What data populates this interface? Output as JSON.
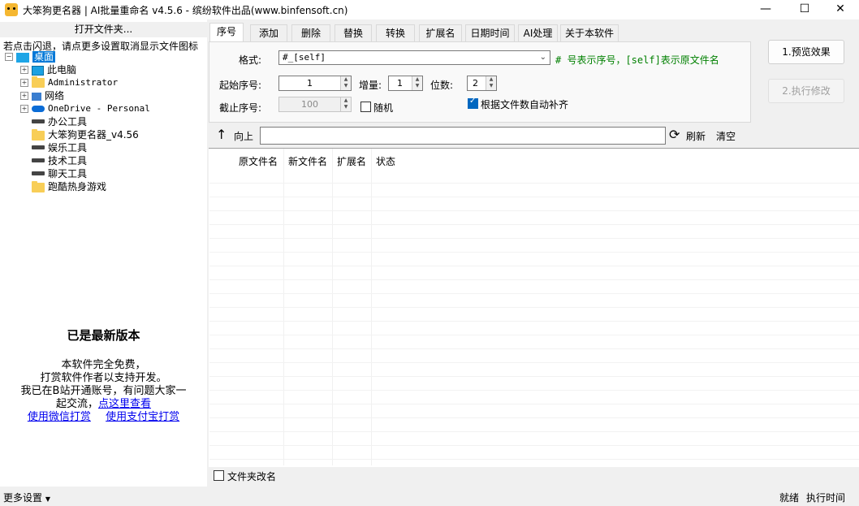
{
  "window": {
    "title": "大笨狗更名器 | AI批量重命名 v4.5.6 - 缤纷软件出品(www.binfensoft.cn)",
    "controls": {
      "minimize": "—",
      "maximize": "☐",
      "close": "✕"
    }
  },
  "left": {
    "open_folder": "打开文件夹...",
    "hint": "若点击闪退，请点更多设置取消显示文件图标",
    "tree": [
      {
        "label": "桌面",
        "icon": "desktop-icon"
      },
      {
        "label": "此电脑",
        "icon": "computer-icon"
      },
      {
        "label": "Administrator",
        "icon": "folder-icon"
      },
      {
        "label": "网络",
        "icon": "network-icon"
      },
      {
        "label": "OneDrive - Personal",
        "icon": "onedrive-icon"
      },
      {
        "label": "办公工具",
        "icon": "drive-icon"
      },
      {
        "label": "大笨狗更名器_v4.56",
        "icon": "folder-icon"
      },
      {
        "label": "娱乐工具",
        "icon": "drive-icon"
      },
      {
        "label": "技术工具",
        "icon": "drive-icon"
      },
      {
        "label": "聊天工具",
        "icon": "drive-icon"
      },
      {
        "label": "跑酷热身游戏",
        "icon": "folder-icon"
      }
    ],
    "info": {
      "latest": "已是最新版本",
      "line1": "本软件完全免费，",
      "line2": "打赏软件作者以支持开发。",
      "line3": "我已在B站开通账号，有问题大家一",
      "line4_prefix": "起交流，",
      "line4_link": "点这里查看",
      "wechat": "使用微信打赏",
      "alipay": "使用支付宝打赏"
    }
  },
  "tabs": [
    "序号",
    "添加",
    "删除",
    "替换",
    "转换",
    "扩展名",
    "日期时间",
    "AI处理",
    "关于本软件"
  ],
  "serial": {
    "format_label": "格式:",
    "format_value": "#_[self]",
    "format_note": "# 号表示序号，[self]表示原文件名",
    "start_label": "起始序号:",
    "start_value": "1",
    "step_label": "增量:",
    "step_value": "1",
    "digits_label": "位数:",
    "digits_value": "2",
    "end_label": "截止序号:",
    "end_value": "100",
    "random_label": "随机",
    "random_checked": false,
    "autopad_label": "根据文件数自动补齐",
    "autopad_checked": true
  },
  "actions": {
    "preview": "1.预览效果",
    "execute": "2.执行修改"
  },
  "nav": {
    "up_label": "向上",
    "path_value": "",
    "refresh": "刷新",
    "clear": "清空"
  },
  "list": {
    "columns": [
      "原文件名",
      "新文件名",
      "扩展名",
      "状态"
    ],
    "rows": []
  },
  "footer": {
    "folder_rename": "文件夹改名",
    "folder_rename_checked": false
  },
  "statusbar": {
    "more_settings": "更多设置",
    "status": "就绪",
    "exec_time": "执行时间"
  }
}
